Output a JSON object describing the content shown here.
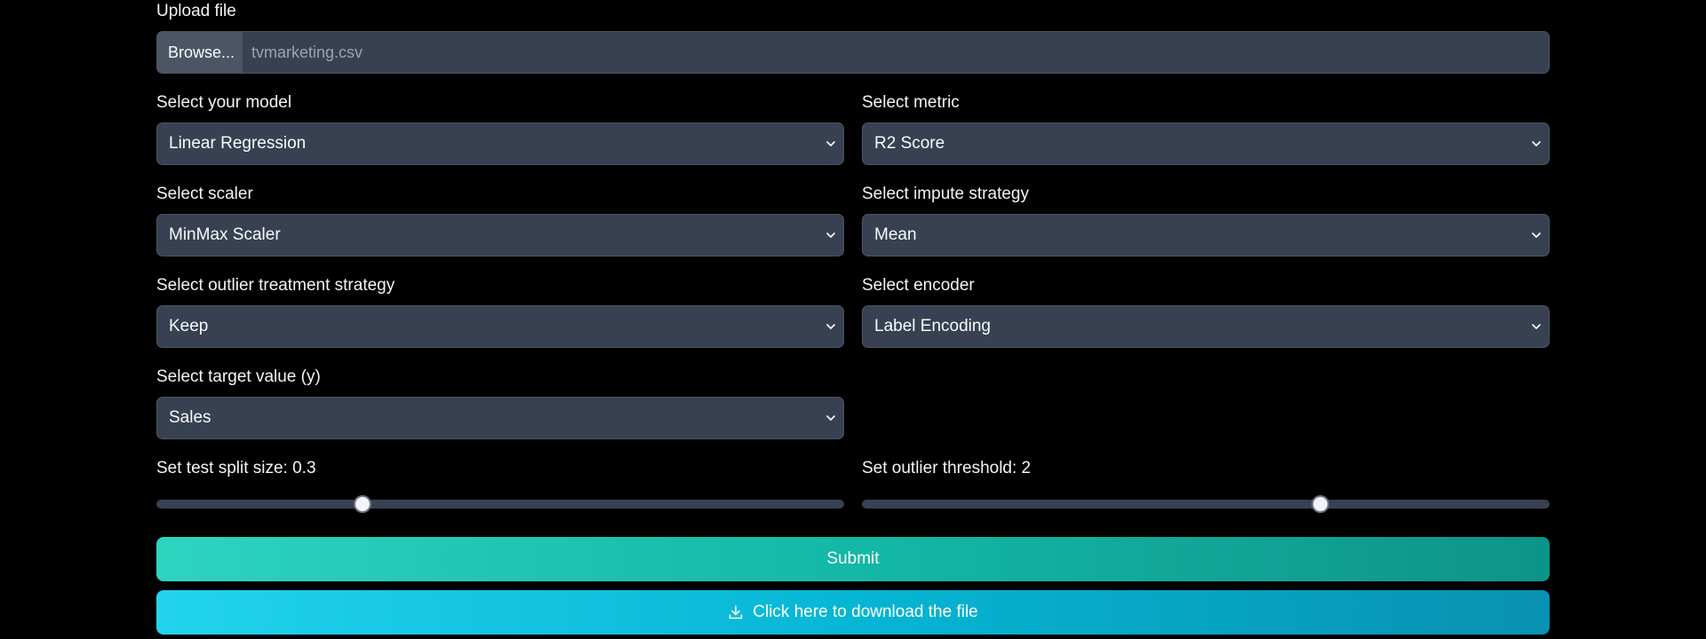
{
  "upload": {
    "label": "Upload file",
    "button_label": "Browse...",
    "file_name": "tvmarketing.csv"
  },
  "fields": {
    "model": {
      "label": "Select your model",
      "value": "Linear Regression"
    },
    "metric": {
      "label": "Select metric",
      "value": "R2 Score"
    },
    "scaler": {
      "label": "Select scaler",
      "value": "MinMax Scaler"
    },
    "impute": {
      "label": "Select impute strategy",
      "value": "Mean"
    },
    "outlier": {
      "label": "Select outlier treatment strategy",
      "value": "Keep"
    },
    "encoder": {
      "label": "Select encoder",
      "value": "Label Encoding"
    },
    "target": {
      "label": "Select target value (y)",
      "value": "Sales"
    }
  },
  "sliders": {
    "test_split": {
      "label": "Set test split size: 0.3",
      "value": 0.3,
      "min": 0,
      "max": 1
    },
    "outlier_threshold": {
      "label": "Set outlier threshold: 2",
      "value": 2,
      "min": 0,
      "max": 3
    }
  },
  "buttons": {
    "submit_label": "Submit",
    "download_label": "Click here to download the file"
  },
  "colors": {
    "background": "#000000",
    "input_bg": "#374151",
    "submit_accent": "#14b8a6",
    "download_accent": "#06b6d4"
  },
  "icons": {
    "select_chevron": "chevron-down-icon",
    "download": "download-icon"
  }
}
